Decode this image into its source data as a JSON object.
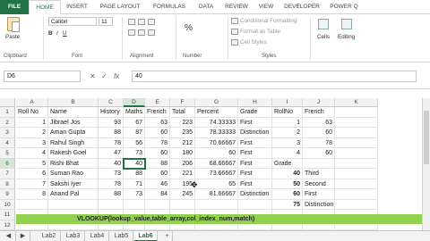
{
  "ribbon_tabs": [
    "FILE",
    "HOME",
    "INSERT",
    "PAGE LAYOUT",
    "FORMULAS",
    "DATA",
    "REVIEW",
    "VIEW",
    "DEVELOPER",
    "POWER Q"
  ],
  "ribbon": {
    "paste": "Paste",
    "clipboard": "Clipboard",
    "font_name": "Calibri",
    "font_size": "11",
    "font": "Font",
    "alignment": "Alignment",
    "percent": "%",
    "number": "Number",
    "conditional": "Conditional Formatting",
    "format_table": "Format as Table",
    "cell_styles": "Cell Styles",
    "styles": "Styles",
    "cells": "Cells",
    "editing": "Editing"
  },
  "formula_bar": {
    "name_box": "D6",
    "cancel": "✕",
    "enter": "✓",
    "fx": "fx",
    "value": "40"
  },
  "columns": [
    "A",
    "B",
    "C",
    "D",
    "E",
    "F",
    "G",
    "H",
    "I",
    "J",
    "K"
  ],
  "selected_column": "D",
  "selected_row": "6",
  "rows": [
    {
      "n": "1",
      "A": "Roll No",
      "B": "Name",
      "C": "History",
      "D": "Maths",
      "E": "French",
      "F": "Total",
      "G": "Percent",
      "H": "Grade",
      "I": "RollNo",
      "J": "French",
      "K": ""
    },
    {
      "n": "2",
      "A": "1",
      "B": "Jibrael Jos",
      "C": "93",
      "D": "67",
      "E": "63",
      "F": "223",
      "G": "74.33333",
      "H": "First",
      "I": "1",
      "J": "63",
      "K": ""
    },
    {
      "n": "3",
      "A": "2",
      "B": "Aman Gupta",
      "C": "88",
      "D": "87",
      "E": "60",
      "F": "235",
      "G": "78.33333",
      "H": "Distinction",
      "I": "2",
      "J": "60",
      "K": ""
    },
    {
      "n": "4",
      "A": "3",
      "B": "Rahul Singh",
      "C": "78",
      "D": "56",
      "E": "78",
      "F": "212",
      "G": "70.66667",
      "H": "First",
      "I": "3",
      "J": "78",
      "K": ""
    },
    {
      "n": "5",
      "A": "4",
      "B": "Rakesh Goel",
      "C": "47",
      "D": "73",
      "E": "60",
      "F": "180",
      "G": "60",
      "H": "First",
      "I": "4",
      "J": "60",
      "K": ""
    },
    {
      "n": "6",
      "A": "5",
      "B": "Rishi Bhat",
      "C": "40",
      "D": "40",
      "E": "88",
      "F": "206",
      "G": "68.66667",
      "H": "First",
      "I": "Grade",
      "J": "",
      "K": ""
    },
    {
      "n": "7",
      "A": "6",
      "B": "Suman Rao",
      "C": "73",
      "D": "88",
      "E": "60",
      "F": "221",
      "G": "73.66667",
      "H": "First",
      "I": "40",
      "J": "Third",
      "K": ""
    },
    {
      "n": "8",
      "A": "7",
      "B": "Sakshi Iyer",
      "C": "78",
      "D": "71",
      "E": "46",
      "F": "195",
      "G": "65",
      "H": "First",
      "I": "50",
      "J": "Second",
      "K": ""
    },
    {
      "n": "9",
      "A": "8",
      "B": "Anand Pal",
      "C": "88",
      "D": "73",
      "E": "84",
      "F": "245",
      "G": "81.66667",
      "H": "Distinction",
      "I": "60",
      "J": "First",
      "K": ""
    },
    {
      "n": "10",
      "A": "",
      "B": "",
      "C": "",
      "D": "",
      "E": "",
      "F": "",
      "G": "",
      "H": "",
      "I": "75",
      "J": "Distinction",
      "K": ""
    },
    {
      "n": "11",
      "A": "",
      "B": "",
      "C": "",
      "D": "",
      "E": "",
      "F": "",
      "G": "",
      "H": "",
      "I": "",
      "J": "",
      "K": ""
    },
    {
      "n": "12",
      "A": "",
      "B": "",
      "C": "",
      "D": "",
      "E": "",
      "F": "",
      "G": "",
      "H": "",
      "I": "",
      "J": "",
      "K": ""
    }
  ],
  "banner": "VLOOKUP(lookup_value,table_array,col_index_num,match)",
  "sheet_tabs": [
    "Lab2",
    "Lab3",
    "Lab4",
    "Lab5",
    "Lab6"
  ],
  "active_sheet": "Lab6",
  "colors": {
    "accent": "#217346",
    "banner": "#92d050"
  }
}
